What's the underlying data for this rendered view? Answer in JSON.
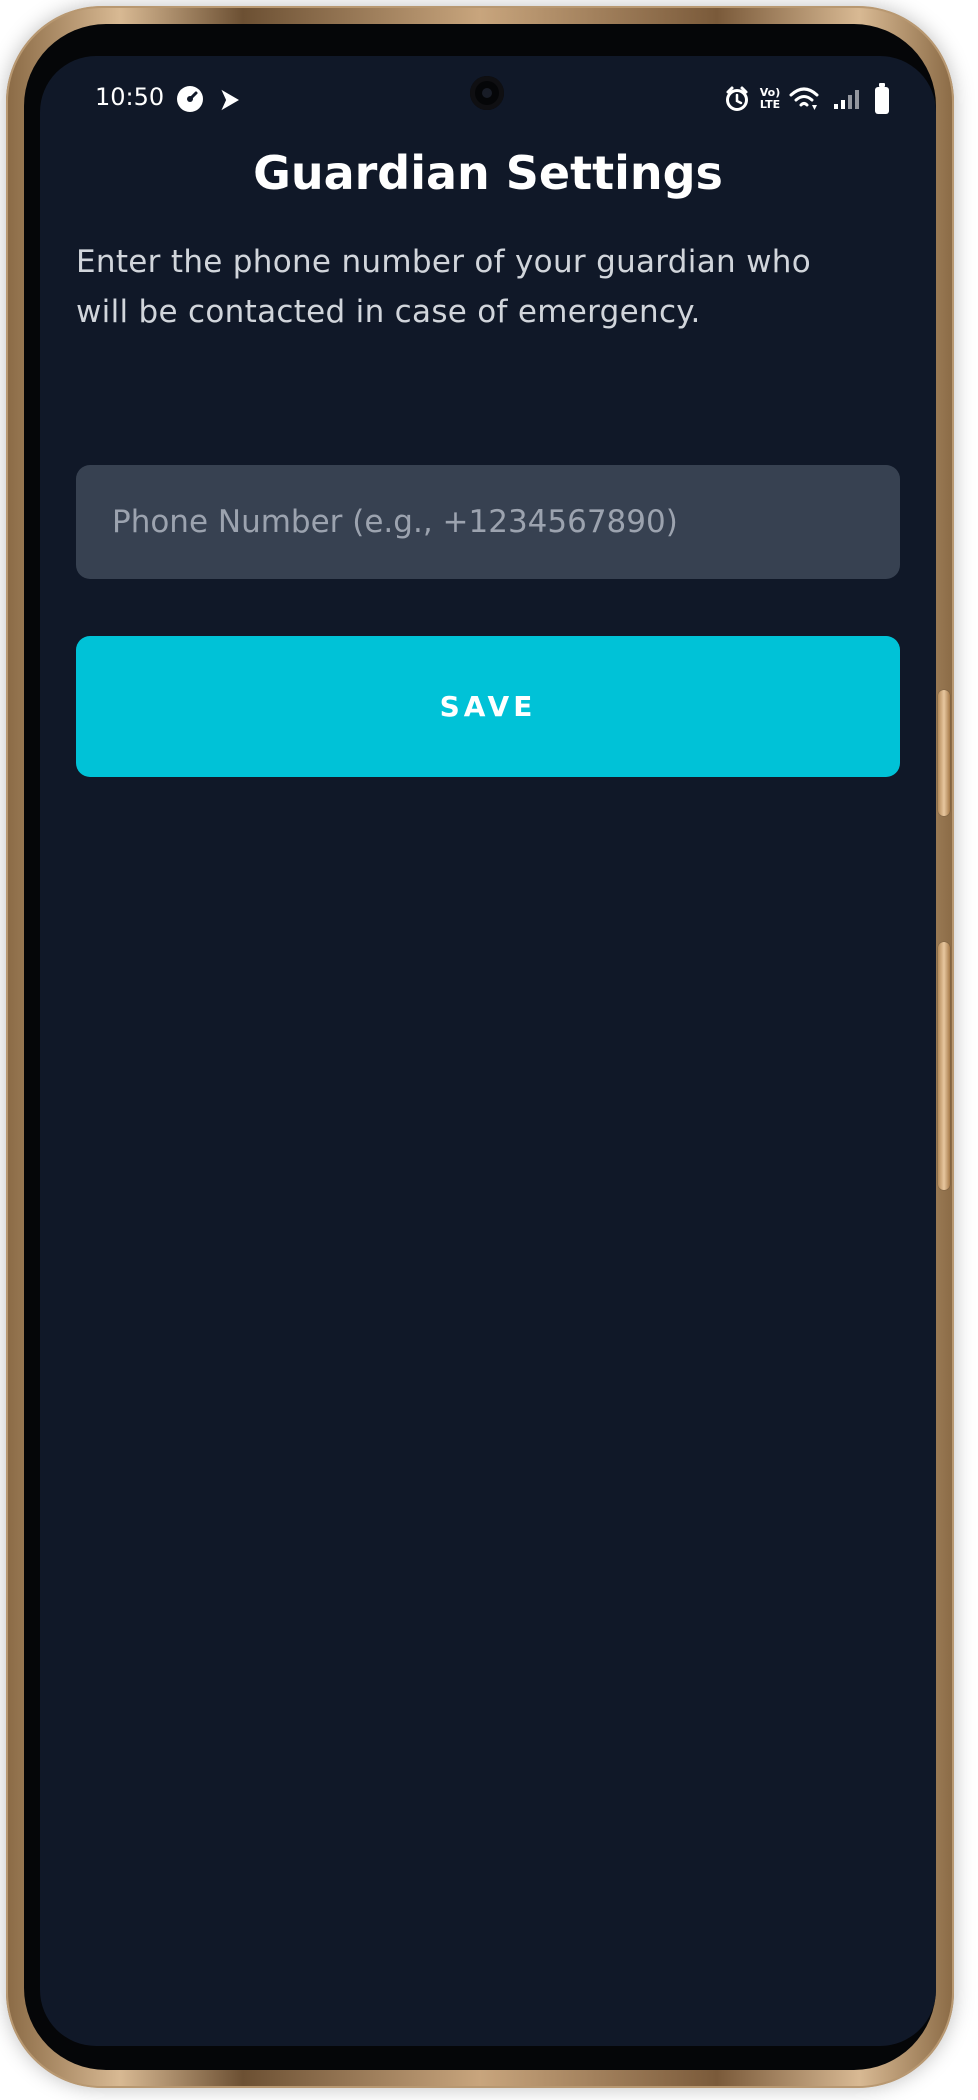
{
  "status_bar": {
    "time": "10:50",
    "left_icons": [
      "speedometer-icon",
      "play-icon"
    ],
    "right_icons": [
      "alarm-icon",
      "volte-icon",
      "wifi-icon",
      "signal-icon",
      "battery-icon"
    ],
    "volte_text": "Vo)\nLTE"
  },
  "screen": {
    "title": "Guardian Settings",
    "description": "Enter the phone number of your guardian who will be contacted in case of emergency.",
    "phone_input": {
      "value": "",
      "placeholder": "Phone Number (e.g., +1234567890)"
    },
    "save_button": {
      "label": "SAVE"
    }
  },
  "colors": {
    "background": "#101828",
    "input_bg": "#374151",
    "button_bg": "#00c2d7",
    "text_primary": "#ffffff",
    "text_secondary": "#d1d5db"
  }
}
